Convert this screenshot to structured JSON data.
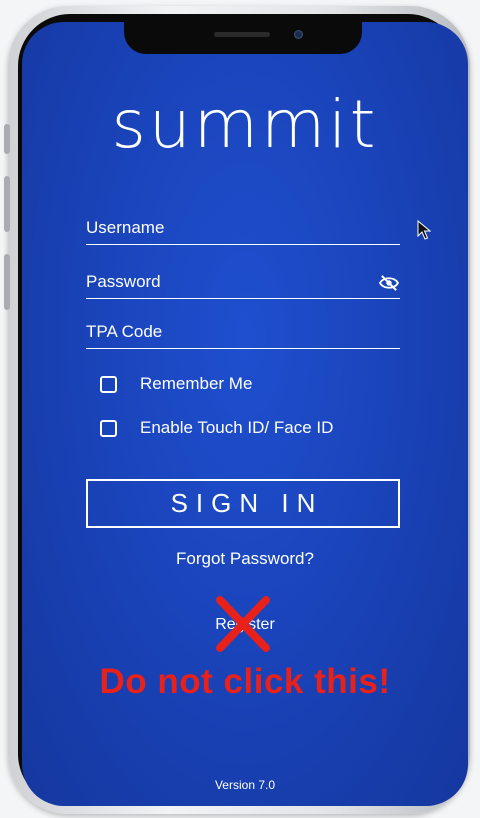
{
  "app": {
    "logo_text": "summit",
    "version": "Version 7.0"
  },
  "form": {
    "username_label": "Username",
    "password_label": "Password",
    "tpa_label": "TPA Code",
    "remember_label": "Remember Me",
    "remember_checked": false,
    "touch_id_label": "Enable Touch ID/ Face ID",
    "touch_id_checked": false,
    "password_visibility_icon": "eye-slash-icon"
  },
  "actions": {
    "sign_in_label": "SIGN IN",
    "forgot_label": "Forgot Password?",
    "register_label": "Register"
  },
  "annotation": {
    "warning_text": "Do not click this!",
    "warning_color": "#e8211b",
    "cross_icon": "red-x-icon"
  },
  "colors": {
    "background": "#1a44bb",
    "text": "#ffffff"
  }
}
